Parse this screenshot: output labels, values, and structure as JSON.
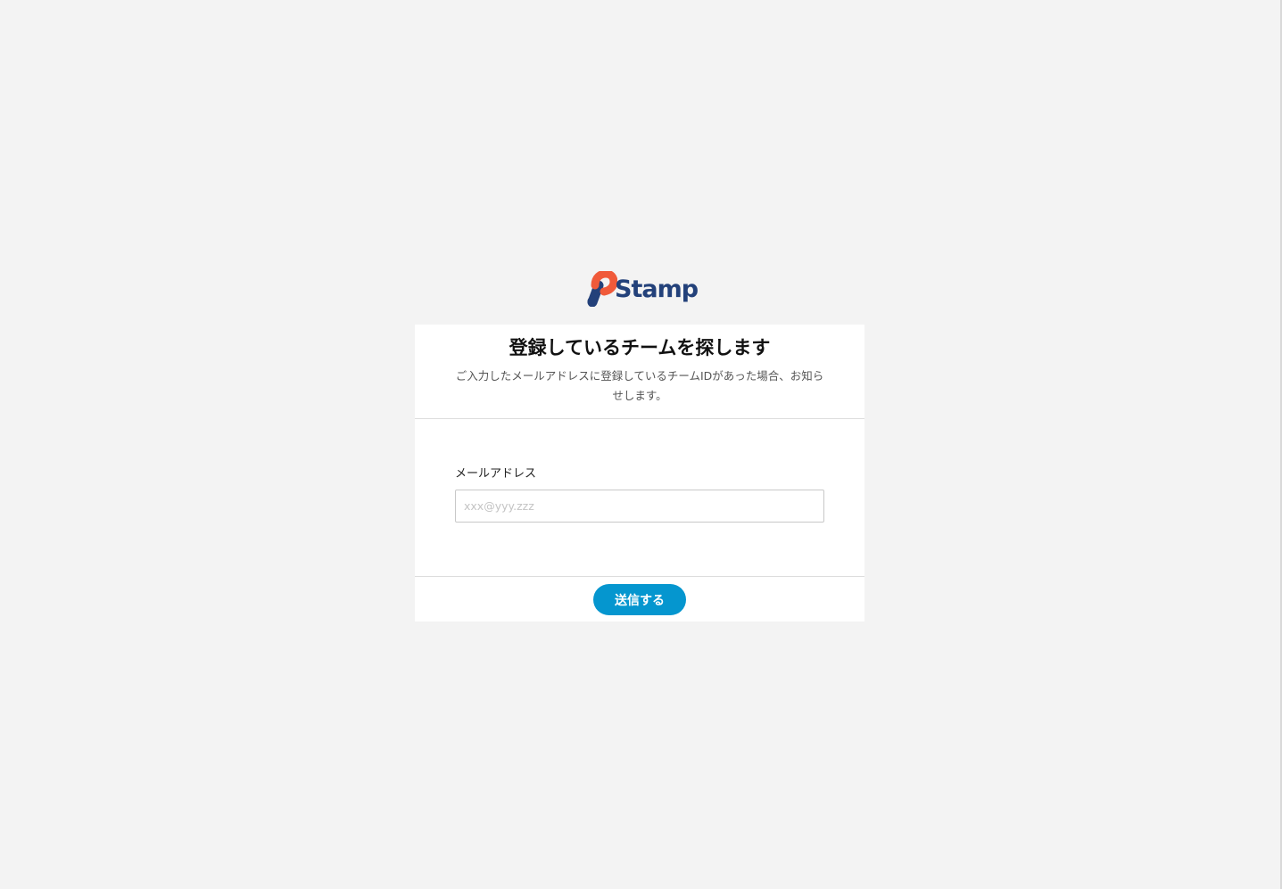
{
  "logo": {
    "text": "Stamp",
    "icon": "stamp-logo-icon",
    "colors": {
      "text": "#23417a",
      "accent": "#f05a3a"
    }
  },
  "card": {
    "title": "登録しているチームを探します",
    "description": "ご入力したメールアドレスに登録しているチームIDがあった場合、お知らせします。"
  },
  "form": {
    "email_label": "メールアドレス",
    "email_value": "",
    "email_placeholder": "xxx@yyy.zzz"
  },
  "footer": {
    "submit_label": "送信する"
  },
  "colors": {
    "page_background": "#f3f3f3",
    "card_background": "#ffffff",
    "button": "#0596cf"
  }
}
